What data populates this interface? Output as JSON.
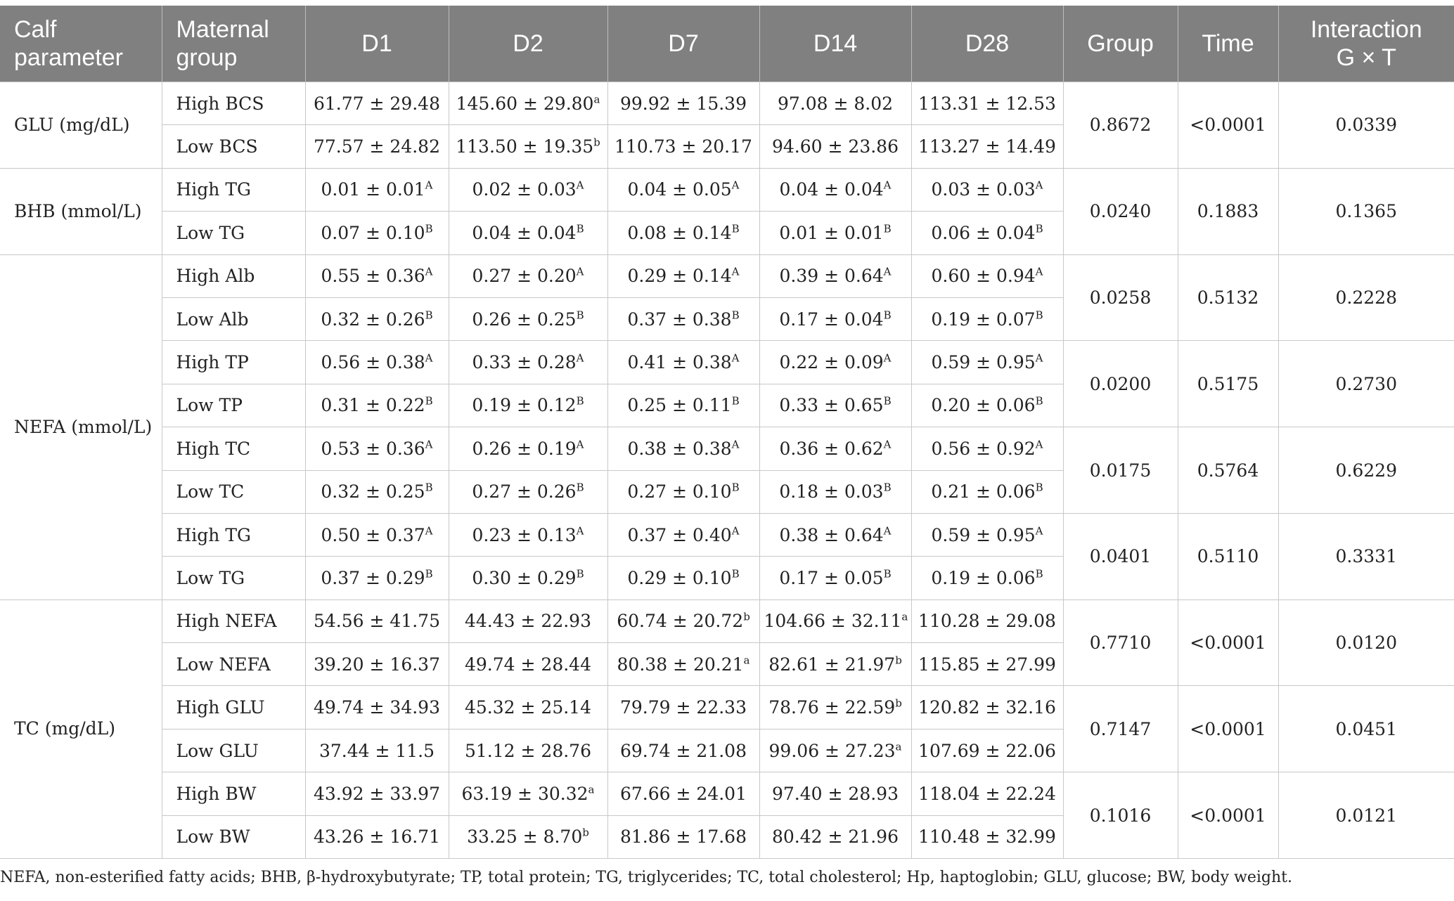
{
  "headers": {
    "param_line1": "Calf",
    "param_line2": "parameter",
    "group_line1": "Maternal",
    "group_line2": "group",
    "d1": "D1",
    "d2": "D2",
    "d7": "D7",
    "d14": "D14",
    "d28": "D28",
    "group": "Group",
    "time": "Time",
    "inter_line1": "Interaction",
    "inter_line2": "G × T"
  },
  "sections": [
    {
      "param": "GLU (mg/dL)",
      "blocks": [
        {
          "group_p": "0.8672",
          "time_p": "<0.0001",
          "inter_p": "0.0339",
          "rows": [
            {
              "name": "High BCS",
              "cells": [
                {
                  "v": "61.77 ± 29.48",
                  "s": ""
                },
                {
                  "v": "145.60 ± 29.80",
                  "s": "a"
                },
                {
                  "v": "99.92 ± 15.39",
                  "s": ""
                },
                {
                  "v": "97.08 ± 8.02",
                  "s": ""
                },
                {
                  "v": "113.31 ± 12.53",
                  "s": ""
                }
              ]
            },
            {
              "name": "Low BCS",
              "cells": [
                {
                  "v": "77.57 ± 24.82",
                  "s": ""
                },
                {
                  "v": "113.50 ± 19.35",
                  "s": "b"
                },
                {
                  "v": "110.73 ± 20.17",
                  "s": ""
                },
                {
                  "v": "94.60 ± 23.86",
                  "s": ""
                },
                {
                  "v": "113.27 ± 14.49",
                  "s": ""
                }
              ]
            }
          ]
        }
      ]
    },
    {
      "param": "BHB (mmol/L)",
      "blocks": [
        {
          "group_p": "0.0240",
          "time_p": "0.1883",
          "inter_p": "0.1365",
          "rows": [
            {
              "name": "High TG",
              "cells": [
                {
                  "v": "0.01 ± 0.01",
                  "s": "A"
                },
                {
                  "v": "0.02 ± 0.03",
                  "s": "A"
                },
                {
                  "v": "0.04 ± 0.05",
                  "s": "A"
                },
                {
                  "v": "0.04 ± 0.04",
                  "s": "A"
                },
                {
                  "v": "0.03 ± 0.03",
                  "s": "A"
                }
              ]
            },
            {
              "name": "Low TG",
              "cells": [
                {
                  "v": "0.07 ± 0.10",
                  "s": "B"
                },
                {
                  "v": "0.04 ± 0.04",
                  "s": "B"
                },
                {
                  "v": "0.08 ± 0.14",
                  "s": "B"
                },
                {
                  "v": "0.01 ± 0.01",
                  "s": "B"
                },
                {
                  "v": "0.06 ± 0.04",
                  "s": "B"
                }
              ]
            }
          ]
        }
      ]
    },
    {
      "param": "NEFA (mmol/L)",
      "blocks": [
        {
          "group_p": "0.0258",
          "time_p": "0.5132",
          "inter_p": "0.2228",
          "rows": [
            {
              "name": "High Alb",
              "cells": [
                {
                  "v": "0.55 ± 0.36",
                  "s": "A"
                },
                {
                  "v": "0.27 ± 0.20",
                  "s": "A"
                },
                {
                  "v": "0.29 ± 0.14",
                  "s": "A"
                },
                {
                  "v": "0.39 ± 0.64",
                  "s": "A"
                },
                {
                  "v": "0.60 ± 0.94",
                  "s": "A"
                }
              ]
            },
            {
              "name": "Low Alb",
              "cells": [
                {
                  "v": "0.32 ± 0.26",
                  "s": "B"
                },
                {
                  "v": "0.26 ± 0.25",
                  "s": "B"
                },
                {
                  "v": "0.37 ± 0.38",
                  "s": "B"
                },
                {
                  "v": "0.17 ± 0.04",
                  "s": "B"
                },
                {
                  "v": "0.19 ± 0.07",
                  "s": "B"
                }
              ]
            }
          ]
        },
        {
          "group_p": "0.0200",
          "time_p": "0.5175",
          "inter_p": "0.2730",
          "rows": [
            {
              "name": "High TP",
              "cells": [
                {
                  "v": "0.56 ± 0.38",
                  "s": "A"
                },
                {
                  "v": "0.33 ± 0.28",
                  "s": "A"
                },
                {
                  "v": "0.41 ± 0.38",
                  "s": "A"
                },
                {
                  "v": "0.22 ± 0.09",
                  "s": "A"
                },
                {
                  "v": "0.59 ± 0.95",
                  "s": "A"
                }
              ]
            },
            {
              "name": "Low TP",
              "cells": [
                {
                  "v": "0.31 ± 0.22",
                  "s": "B"
                },
                {
                  "v": "0.19 ± 0.12",
                  "s": "B"
                },
                {
                  "v": "0.25 ± 0.11",
                  "s": "B"
                },
                {
                  "v": "0.33 ± 0.65",
                  "s": "B"
                },
                {
                  "v": "0.20 ± 0.06",
                  "s": "B"
                }
              ]
            }
          ]
        },
        {
          "group_p": "0.0175",
          "time_p": "0.5764",
          "inter_p": "0.6229",
          "rows": [
            {
              "name": "High TC",
              "cells": [
                {
                  "v": "0.53 ± 0.36",
                  "s": "A"
                },
                {
                  "v": "0.26 ± 0.19",
                  "s": "A"
                },
                {
                  "v": "0.38 ± 0.38",
                  "s": "A"
                },
                {
                  "v": "0.36 ± 0.62",
                  "s": "A"
                },
                {
                  "v": "0.56 ± 0.92",
                  "s": "A"
                }
              ]
            },
            {
              "name": "Low TC",
              "cells": [
                {
                  "v": "0.32 ± 0.25",
                  "s": "B"
                },
                {
                  "v": "0.27 ± 0.26",
                  "s": "B"
                },
                {
                  "v": "0.27 ± 0.10",
                  "s": "B"
                },
                {
                  "v": "0.18 ± 0.03",
                  "s": "B"
                },
                {
                  "v": "0.21 ± 0.06",
                  "s": "B"
                }
              ]
            }
          ]
        },
        {
          "group_p": "0.0401",
          "time_p": "0.5110",
          "inter_p": "0.3331",
          "rows": [
            {
              "name": "High TG",
              "cells": [
                {
                  "v": "0.50 ± 0.37",
                  "s": "A"
                },
                {
                  "v": "0.23 ± 0.13",
                  "s": "A"
                },
                {
                  "v": "0.37 ± 0.40",
                  "s": "A"
                },
                {
                  "v": "0.38 ± 0.64",
                  "s": "A"
                },
                {
                  "v": "0.59 ± 0.95",
                  "s": "A"
                }
              ]
            },
            {
              "name": "Low TG",
              "cells": [
                {
                  "v": "0.37 ± 0.29",
                  "s": "B"
                },
                {
                  "v": "0.30 ± 0.29",
                  "s": "B"
                },
                {
                  "v": "0.29 ± 0.10",
                  "s": "B"
                },
                {
                  "v": "0.17 ± 0.05",
                  "s": "B"
                },
                {
                  "v": "0.19 ± 0.06",
                  "s": "B"
                }
              ]
            }
          ]
        }
      ]
    },
    {
      "param": "TC (mg/dL)",
      "blocks": [
        {
          "group_p": "0.7710",
          "time_p": "<0.0001",
          "inter_p": "0.0120",
          "rows": [
            {
              "name": "High NEFA",
              "cells": [
                {
                  "v": "54.56 ± 41.75",
                  "s": ""
                },
                {
                  "v": "44.43 ± 22.93",
                  "s": ""
                },
                {
                  "v": "60.74 ± 20.72",
                  "s": "b"
                },
                {
                  "v": "104.66 ± 32.11",
                  "s": "a"
                },
                {
                  "v": "110.28 ± 29.08",
                  "s": ""
                }
              ]
            },
            {
              "name": "Low NEFA",
              "cells": [
                {
                  "v": "39.20 ± 16.37",
                  "s": ""
                },
                {
                  "v": "49.74 ± 28.44",
                  "s": ""
                },
                {
                  "v": "80.38 ± 20.21",
                  "s": "a"
                },
                {
                  "v": "82.61 ± 21.97",
                  "s": "b"
                },
                {
                  "v": "115.85 ± 27.99",
                  "s": ""
                }
              ]
            }
          ]
        },
        {
          "group_p": "0.7147",
          "time_p": "<0.0001",
          "inter_p": "0.0451",
          "rows": [
            {
              "name": "High GLU",
              "cells": [
                {
                  "v": "49.74 ± 34.93",
                  "s": ""
                },
                {
                  "v": "45.32 ± 25.14",
                  "s": ""
                },
                {
                  "v": "79.79 ± 22.33",
                  "s": ""
                },
                {
                  "v": "78.76 ± 22.59",
                  "s": "b"
                },
                {
                  "v": "120.82 ± 32.16",
                  "s": ""
                }
              ]
            },
            {
              "name": "Low GLU",
              "cells": [
                {
                  "v": "37.44 ± 11.5",
                  "s": ""
                },
                {
                  "v": "51.12 ± 28.76",
                  "s": ""
                },
                {
                  "v": "69.74 ± 21.08",
                  "s": ""
                },
                {
                  "v": "99.06 ± 27.23",
                  "s": "a"
                },
                {
                  "v": "107.69 ± 22.06",
                  "s": ""
                }
              ]
            }
          ]
        },
        {
          "group_p": "0.1016",
          "time_p": "<0.0001",
          "inter_p": "0.0121",
          "rows": [
            {
              "name": "High BW",
              "cells": [
                {
                  "v": "43.92 ± 33.97",
                  "s": ""
                },
                {
                  "v": "63.19 ± 30.32",
                  "s": "a"
                },
                {
                  "v": "67.66 ± 24.01",
                  "s": ""
                },
                {
                  "v": "97.40 ± 28.93",
                  "s": ""
                },
                {
                  "v": "118.04 ± 22.24",
                  "s": ""
                }
              ]
            },
            {
              "name": "Low BW",
              "cells": [
                {
                  "v": "43.26 ± 16.71",
                  "s": ""
                },
                {
                  "v": "33.25 ± 8.70",
                  "s": "b"
                },
                {
                  "v": "81.86 ± 17.68",
                  "s": ""
                },
                {
                  "v": "80.42 ± 21.96",
                  "s": ""
                },
                {
                  "v": "110.48 ± 32.99",
                  "s": ""
                }
              ]
            }
          ]
        }
      ]
    }
  ],
  "footnote": "NEFA, non-esterified fatty acids; BHB, β-hydroxybutyrate; TP, total protein; TG, triglycerides; TC, total cholesterol; Hp, haptoglobin; GLU, glucose; BW, body weight."
}
